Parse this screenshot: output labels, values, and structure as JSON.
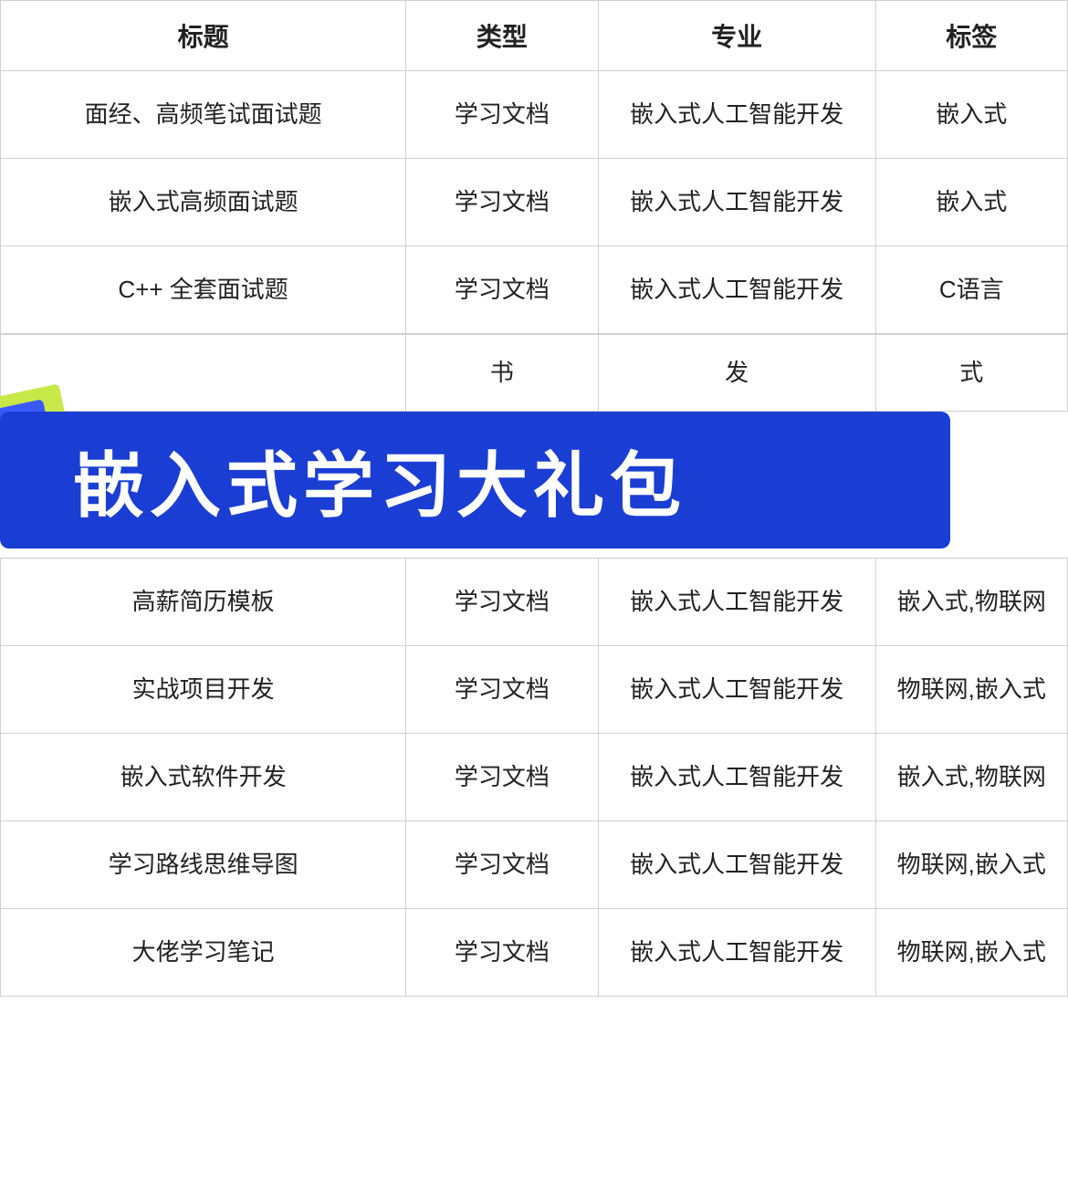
{
  "header": {
    "col1": "标题",
    "col2": "类型",
    "col3": "专业",
    "col4": "标签"
  },
  "rows_top": [
    {
      "name": "面经、高频笔试面试题",
      "type": "学习文档",
      "major": "嵌入式人工智能开发",
      "tag": "嵌入式"
    },
    {
      "name": "嵌入式高频面试题",
      "type": "学习文档",
      "major": "嵌入式人工智能开发",
      "tag": "嵌入式"
    },
    {
      "name": "C++ 全套面试题",
      "type": "学习文档",
      "major": "嵌入式人工智能开发",
      "tag": "C语言"
    }
  ],
  "partial_row": {
    "type": "书",
    "major": "发",
    "tag": "式"
  },
  "banner": {
    "text": "嵌入式学习大礼包"
  },
  "rows_bottom": [
    {
      "name": "高薪简历模板",
      "type": "学习文档",
      "major": "嵌入式人工智能开发",
      "tag": "嵌入式,物联网"
    },
    {
      "name": "实战项目开发",
      "type": "学习文档",
      "major": "嵌入式人工智能开发",
      "tag": "物联网,嵌入式"
    },
    {
      "name": "嵌入式软件开发",
      "type": "学习文档",
      "major": "嵌入式人工智能开发",
      "tag": "嵌入式,物联网"
    },
    {
      "name": "学习路线思维导图",
      "type": "学习文档",
      "major": "嵌入式人工智能开发",
      "tag": "物联网,嵌入式"
    },
    {
      "name": "大佬学习笔记",
      "type": "学习文档",
      "major": "嵌入式人工智能开发",
      "tag": "物联网,嵌入式"
    }
  ]
}
